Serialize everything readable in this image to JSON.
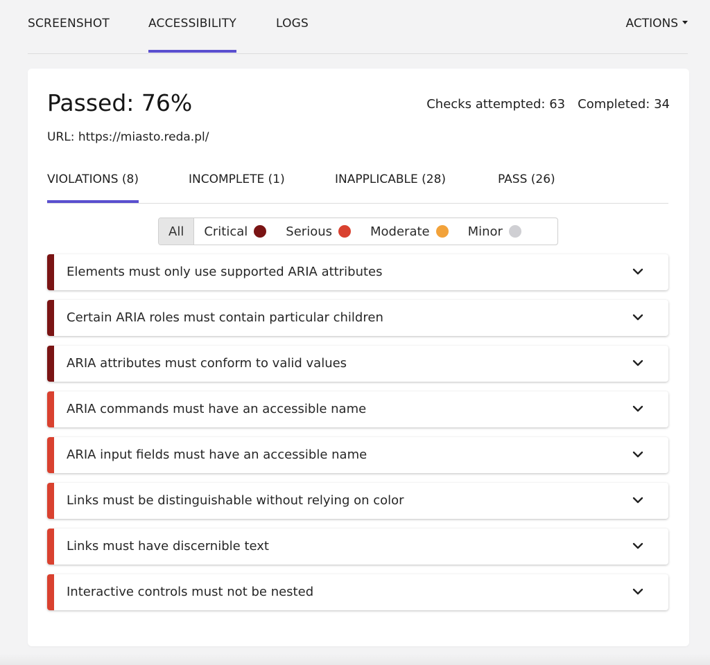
{
  "top_tabs": [
    {
      "label": "SCREENSHOT",
      "active": false
    },
    {
      "label": "ACCESSIBILITY",
      "active": true
    },
    {
      "label": "LOGS",
      "active": false
    }
  ],
  "actions_label": "ACTIONS",
  "summary": {
    "passed": "Passed: 76%",
    "checks_attempted": "Checks attempted: 63",
    "completed": "Completed: 34",
    "url": "URL: https://miasto.reda.pl/"
  },
  "sub_tabs": [
    {
      "label": "VIOLATIONS (8)",
      "active": true
    },
    {
      "label": "INCOMPLETE (1)",
      "active": false
    },
    {
      "label": "INAPPLICABLE (28)",
      "active": false
    },
    {
      "label": "PASS (26)",
      "active": false
    }
  ],
  "filters": [
    {
      "label": "All",
      "color": null,
      "active": true
    },
    {
      "label": "Critical",
      "color": "#7a1414",
      "active": false
    },
    {
      "label": "Serious",
      "color": "#d9412f",
      "active": false
    },
    {
      "label": "Moderate",
      "color": "#f2a23a",
      "active": false
    },
    {
      "label": "Minor",
      "color": "#cfcfd3",
      "active": false
    }
  ],
  "violations": [
    {
      "label": "Elements must only use supported ARIA attributes",
      "severity": "critical"
    },
    {
      "label": "Certain ARIA roles must contain particular children",
      "severity": "critical"
    },
    {
      "label": "ARIA attributes must conform to valid values",
      "severity": "critical"
    },
    {
      "label": "ARIA commands must have an accessible name",
      "severity": "serious"
    },
    {
      "label": "ARIA input fields must have an accessible name",
      "severity": "serious"
    },
    {
      "label": "Links must be distinguishable without relying on color",
      "severity": "serious"
    },
    {
      "label": "Links must have discernible text",
      "severity": "serious"
    },
    {
      "label": "Interactive controls must not be nested",
      "severity": "serious"
    }
  ],
  "severity_colors": {
    "critical": "#7a1414",
    "serious": "#d9412f"
  },
  "accent_color": "#5a4fcf"
}
